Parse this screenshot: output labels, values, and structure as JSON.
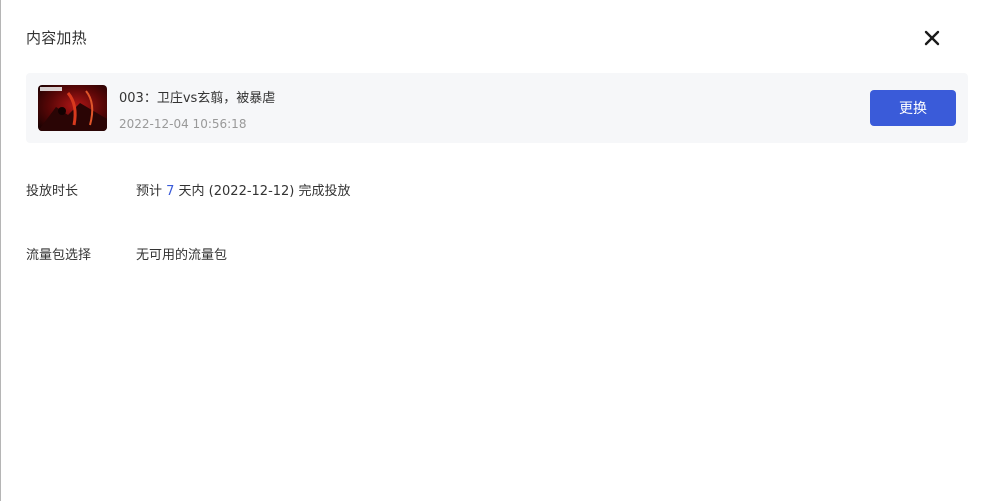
{
  "dialog": {
    "title": "内容加热",
    "close_icon": "close-icon"
  },
  "video": {
    "title": "003：卫庄vs玄翦，被暴虐",
    "timestamp": "2022-12-04 10:56:18",
    "thumbnail_icon": "video-thumbnail",
    "replace_label": "更换"
  },
  "duration": {
    "label": "投放时长",
    "prefix": "预计 ",
    "days": "7",
    "suffix": " 天内 (2022-12-12) 完成投放"
  },
  "traffic": {
    "label": "流量包选择",
    "value": "无可用的流量包"
  },
  "colors": {
    "accent": "#3a5bd9",
    "card_bg": "#f6f7f9",
    "muted_text": "#999999"
  }
}
